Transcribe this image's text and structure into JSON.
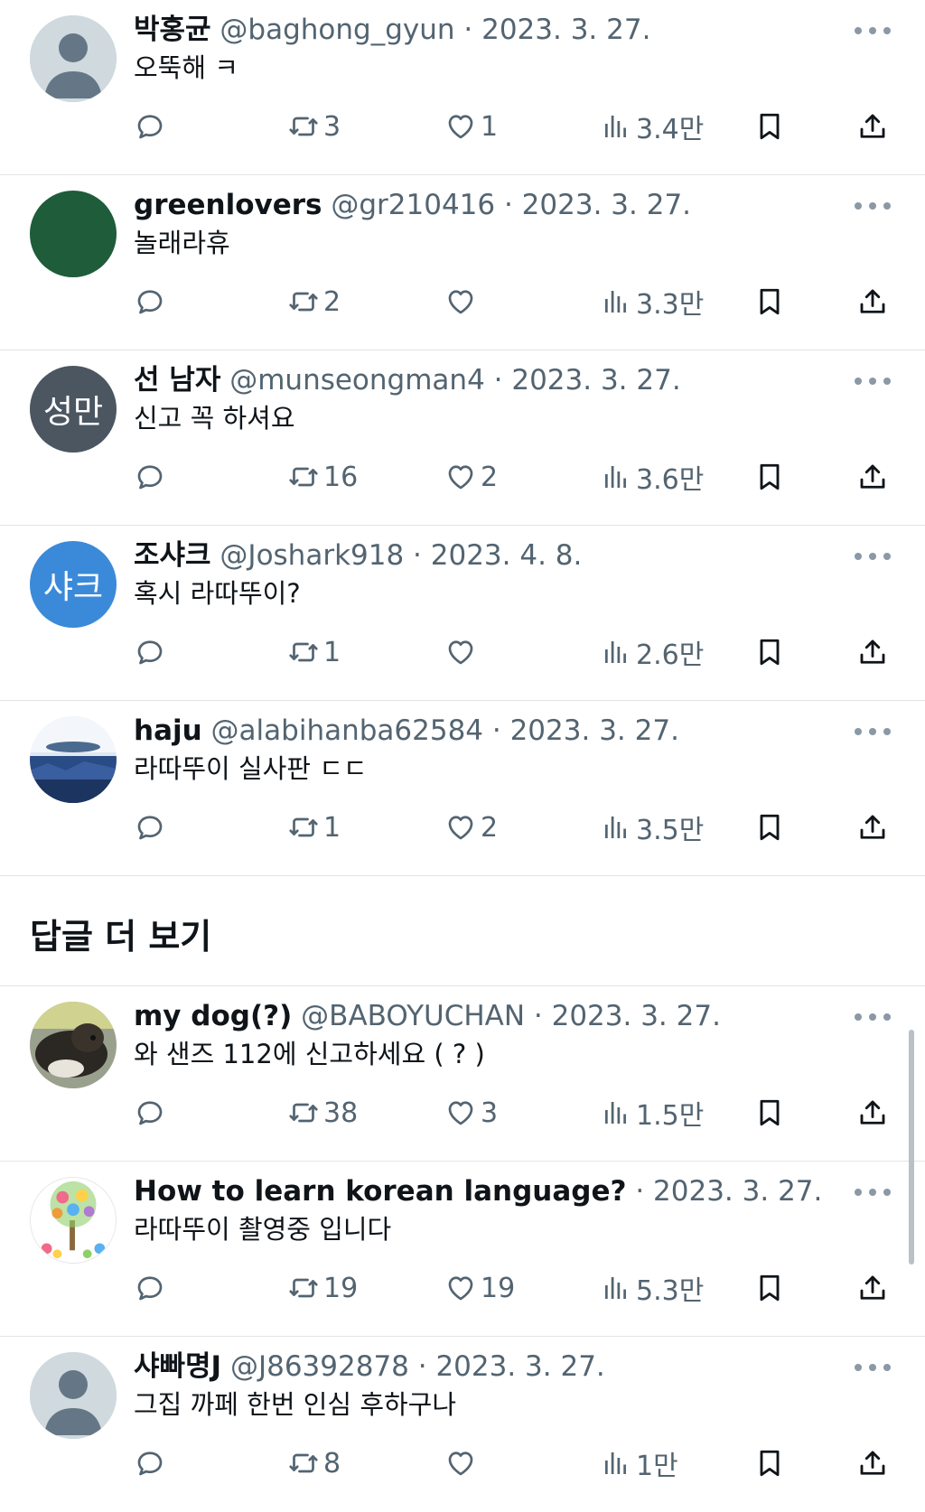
{
  "replies": [
    {
      "name": "박홍균",
      "handle": "@baghong_gyun · 2023. 3. 27.",
      "text": "오뚝해 ㅋ",
      "retweets": "3",
      "likes": "1",
      "views": "3.4만",
      "avatar_type": "default",
      "avatar_text": ""
    },
    {
      "name": "greenlovers",
      "handle": "@gr210416 · 2023. 3. 27.",
      "text": "놀래라휴",
      "retweets": "2",
      "likes": "",
      "views": "3.3만",
      "avatar_type": "green",
      "avatar_text": ""
    },
    {
      "name": "선 남자",
      "handle": "@munseongman4 · 2023. 3. 27.",
      "text": "신고 꼭 하셔요",
      "retweets": "16",
      "likes": "2",
      "views": "3.6만",
      "avatar_type": "slate-text",
      "avatar_text": "성만"
    },
    {
      "name": "조샤크",
      "handle": "@Joshark918 · 2023. 4. 8.",
      "text": "혹시 라따뚜이?",
      "retweets": "1",
      "likes": "",
      "views": "2.6만",
      "avatar_type": "blue-text",
      "avatar_text": "샤크"
    },
    {
      "name": "haju",
      "handle": "@alabihanba62584 · 2023. 3. 27.",
      "text": "라따뚜이 실사판 ㄷㄷ",
      "retweets": "1",
      "likes": "2",
      "views": "3.5만",
      "avatar_type": "landscape",
      "avatar_text": ""
    }
  ],
  "more_replies_title": "답글 더 보기",
  "more_replies": [
    {
      "name": "my dog(?)",
      "handle": "@BABOYUCHAN · 2023. 3. 27.",
      "text": "와 샌즈 112에 신고하세요 ( ? )",
      "retweets": "38",
      "likes": "3",
      "views": "1.5만",
      "avatar_type": "dog",
      "avatar_text": ""
    },
    {
      "name": "How to learn korean language?",
      "handle": "· 2023. 3. 27.",
      "text": "라따뚜이 촬영중 입니다",
      "retweets": "19",
      "likes": "19",
      "views": "5.3만",
      "avatar_type": "flowers",
      "avatar_text": ""
    },
    {
      "name": "샤빠명J",
      "handle": "@J86392878 · 2023. 3. 27.",
      "text": "그집 까페 한번 인심 후하구나",
      "retweets": "8",
      "likes": "",
      "views": "1만",
      "avatar_type": "default",
      "avatar_text": ""
    }
  ],
  "colors": {
    "text": "#0f1419",
    "secondary": "#536471",
    "divider": "#e1e4e8",
    "green_avatar": "#1e5c3a",
    "slate_avatar": "#4b5661",
    "blue_avatar": "#3b8ad9"
  },
  "icons": [
    "reply-icon",
    "retweet-icon",
    "like-icon",
    "views-icon",
    "bookmark-icon",
    "share-icon",
    "more-icon"
  ]
}
